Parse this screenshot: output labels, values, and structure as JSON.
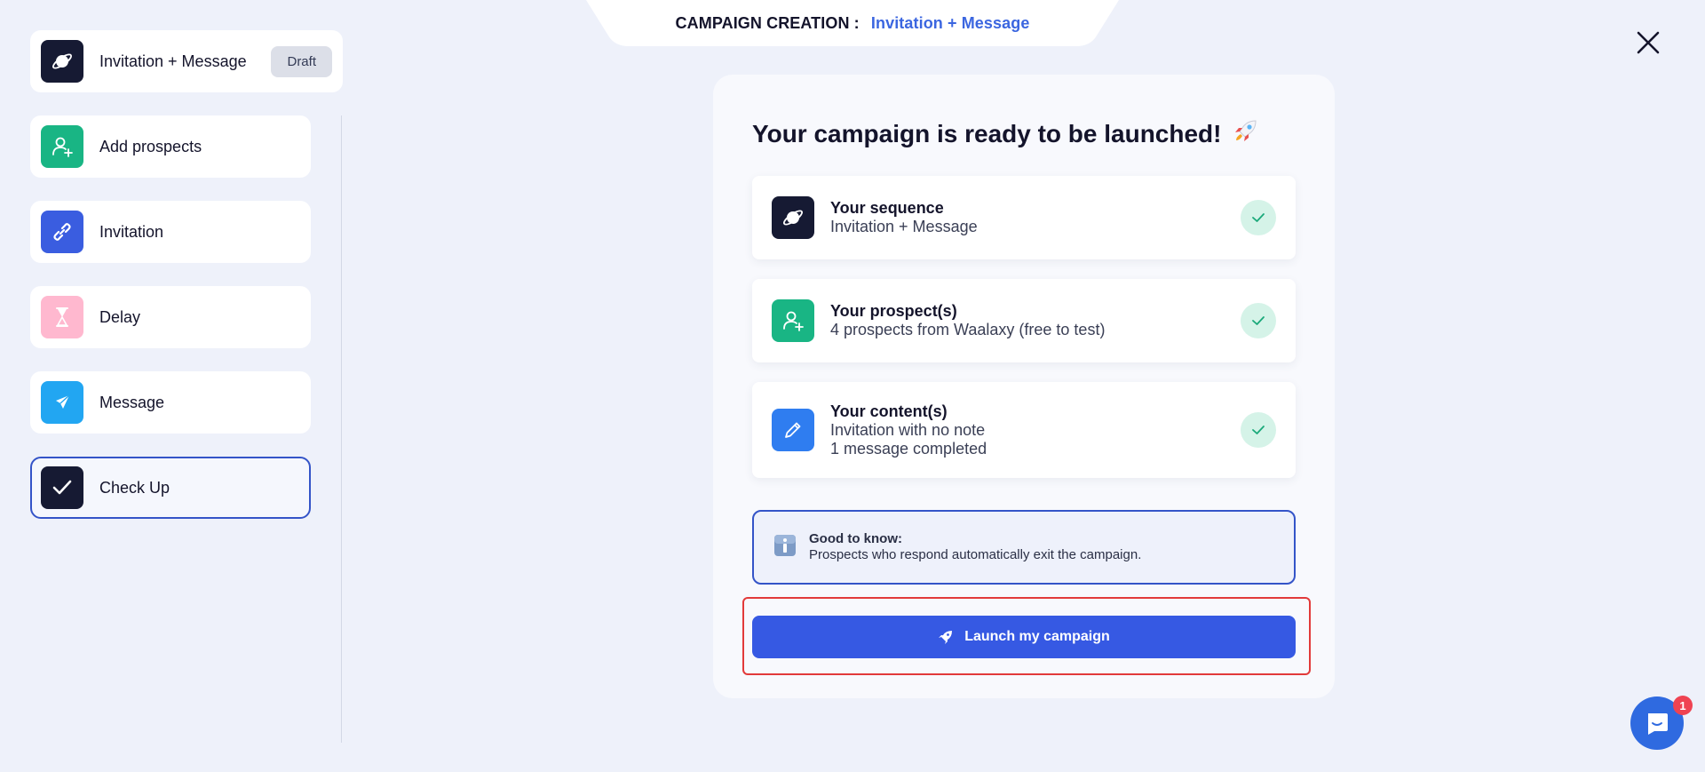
{
  "header": {
    "prefix": "CAMPAIGN CREATION :",
    "campaign_name": "Invitation + Message"
  },
  "sidebar": {
    "sequence": {
      "label": "Invitation + Message",
      "badge": "Draft",
      "icon": "planet-icon"
    },
    "steps": [
      {
        "label": "Add prospects",
        "icon": "add-user-icon",
        "color": "#19b584"
      },
      {
        "label": "Invitation",
        "icon": "link-icon",
        "color": "#3a5de0"
      },
      {
        "label": "Delay",
        "icon": "hourglass-icon",
        "color": "#ffb8cf"
      },
      {
        "label": "Message",
        "icon": "send-icon",
        "color": "#22a6f2"
      },
      {
        "label": "Check Up",
        "icon": "check-icon",
        "color": "#161a33",
        "active": true
      }
    ]
  },
  "panel": {
    "title": "Your campaign is ready to be launched!",
    "cards": [
      {
        "title": "Your sequence",
        "lines": [
          "Invitation + Message"
        ],
        "icon": "planet-icon"
      },
      {
        "title": "Your prospect(s)",
        "lines": [
          "4 prospects from Waalaxy (free to test)"
        ],
        "icon": "add-user-icon"
      },
      {
        "title": "Your content(s)",
        "lines": [
          "Invitation with no note",
          "1 message completed"
        ],
        "icon": "pencil-icon"
      }
    ],
    "info": {
      "title": "Good to know:",
      "text": "Prospects who respond automatically exit the campaign."
    },
    "launch_label": "Launch my campaign"
  },
  "chat": {
    "badge": "1"
  },
  "colors": {
    "accent": "#3659e3",
    "highlight": "#e23a3a",
    "success": "#19b584"
  }
}
